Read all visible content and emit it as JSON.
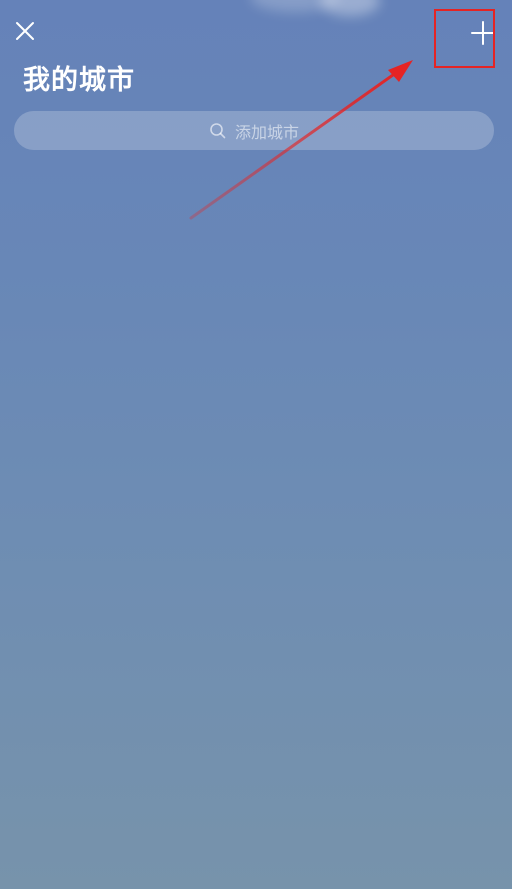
{
  "header": {
    "close_icon": "close-icon",
    "add_icon": "plus-icon",
    "title": "我的城市"
  },
  "search": {
    "placeholder": "添加城市",
    "icon": "search-icon"
  },
  "colors": {
    "background_top": "#6582b9",
    "background_bottom": "#7793ab",
    "annotation_red": "#e52424",
    "text_white": "#ffffff"
  }
}
